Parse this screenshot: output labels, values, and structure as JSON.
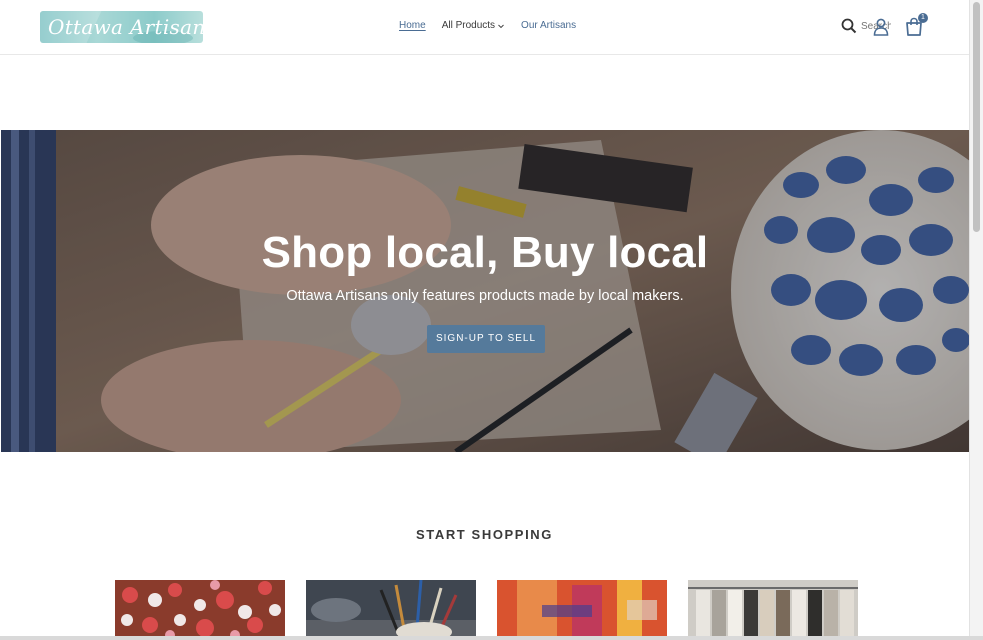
{
  "header": {
    "logo_text": "Ottawa Artisans",
    "nav": [
      {
        "label": "Home",
        "active": true
      },
      {
        "label": "All Products",
        "has_dropdown": true
      },
      {
        "label": "Our Artisans"
      }
    ],
    "search_placeholder": "Search",
    "cart_count": "1"
  },
  "hero": {
    "title": "Shop local, Buy local",
    "subtitle": "Ottawa Artisans only features products made by local makers.",
    "button_label": "SIGN-UP TO SELL"
  },
  "collections": {
    "title": "START SHOPPING",
    "items": [
      {
        "image": "hearts"
      },
      {
        "image": "brushes"
      },
      {
        "image": "painting"
      },
      {
        "image": "clothing-rack"
      }
    ]
  },
  "colors": {
    "accent": "#557a9b",
    "link": "#4a6c93",
    "logo": "#8ccbca"
  }
}
